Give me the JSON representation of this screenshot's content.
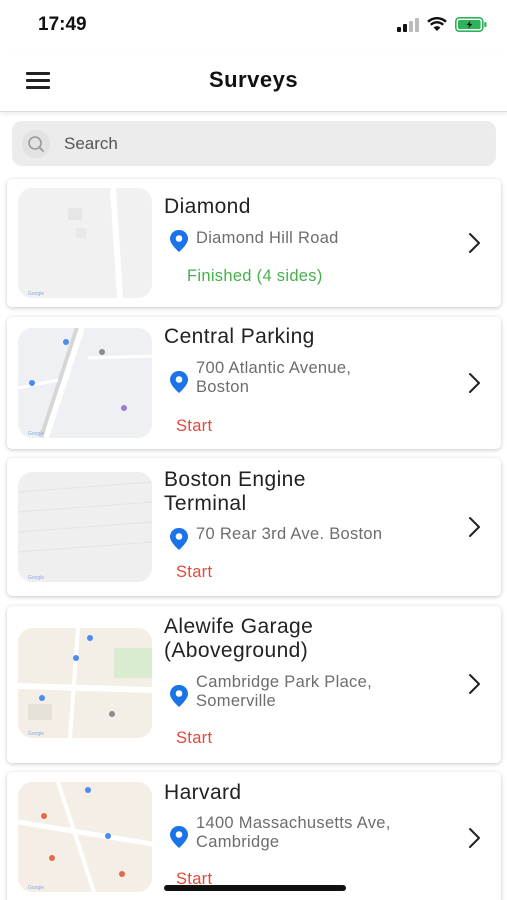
{
  "status_bar": {
    "time": "17:49"
  },
  "header": {
    "title": "Surveys"
  },
  "search": {
    "placeholder": "Search"
  },
  "surveys": [
    {
      "name": "Diamond",
      "address": "Diamond Hill Road",
      "status": "Finished (4 sides)",
      "status_type": "finished"
    },
    {
      "name": "Central Parking",
      "address": "700 Atlantic Avenue,\nBoston",
      "status": "Start",
      "status_type": "start"
    },
    {
      "name": "Boston Engine\nTerminal",
      "address": "70 Rear 3rd Ave. Boston",
      "status": "Start",
      "status_type": "start"
    },
    {
      "name": "Alewife Garage\n(Aboveground)",
      "address": "Cambridge Park Place,\nSomerville",
      "status": "Start",
      "status_type": "start"
    },
    {
      "name": "Harvard",
      "address": "1400 Massachusetts Ave,\nCambridge",
      "status": "Start",
      "status_type": "start"
    }
  ],
  "colors": {
    "finished": "#46b04a",
    "start": "#e04a3a",
    "pin": "#1a73e8"
  }
}
